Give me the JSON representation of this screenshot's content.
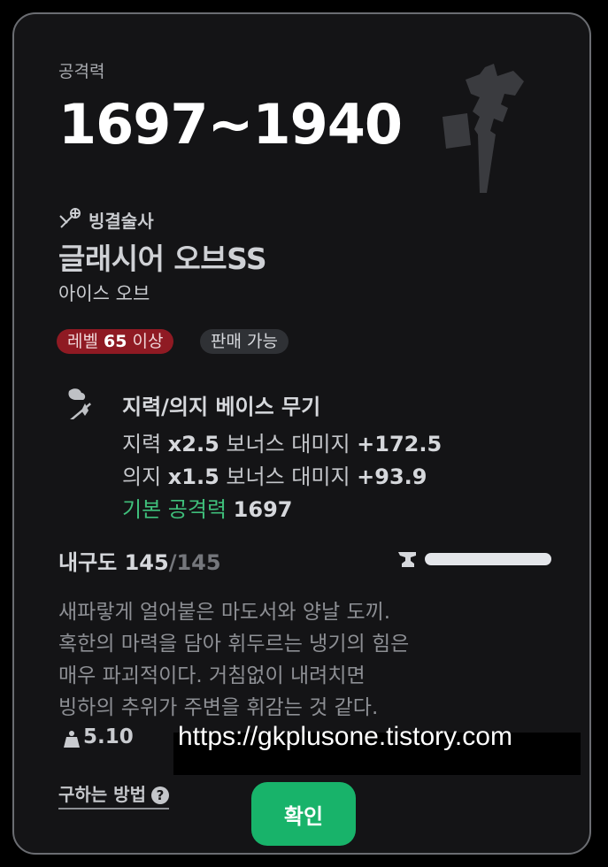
{
  "header": {
    "label": "공격력",
    "value": "1697~1940"
  },
  "item": {
    "job_icon": "crossed-staff-snowflake-icon",
    "job": "빙결술사",
    "name": "글래시어 오브SS",
    "type": "아이스 오브",
    "weapon_icon": "ice-axe-weapon-icon"
  },
  "badges": {
    "level_prefix": "레벨 ",
    "level_value": "65",
    "level_suffix": " 이상",
    "sellable": "판매 가능"
  },
  "stats": {
    "icon": "intelligence-will-icon",
    "title": "지력/의지 베이스 무기",
    "int_label": "지력 ",
    "int_mult": "x2.5",
    "int_mid": " 보너스 대미지 ",
    "int_bonus": "+172.5",
    "will_label": "의지 ",
    "will_mult": "x1.5",
    "will_mid": " 보너스 대미지 ",
    "will_bonus": "+93.9",
    "base_label": "기본 공격력 ",
    "base_value": "1697"
  },
  "durability": {
    "label": "내구도 ",
    "current": "145",
    "max": "/145",
    "icon": "anvil-icon",
    "fill_fraction": 1.0
  },
  "description": {
    "line1": "새파랗게 얼어붙은 마도서와 양날 도끼.",
    "line2": "혹한의 마력을 담아 휘두르는 냉기의 힘은",
    "line3": "매우 파괴적이다. 거침없이 내려치면",
    "line4": "빙하의 추위가 주변을 휘감는 것 같다."
  },
  "weight": {
    "icon": "weight-icon",
    "value": "5.10"
  },
  "watermark": "https://gkplusone.tistory.com",
  "footer": {
    "howto": "구하는 방법",
    "help_icon": "question-circle-icon",
    "help_glyph": "?",
    "confirm": "확인"
  },
  "colors": {
    "card_bg": "#141416",
    "level_badge": "#8f1a23",
    "base_attack_green": "#3fbf7b",
    "confirm_green": "#18b36a"
  }
}
